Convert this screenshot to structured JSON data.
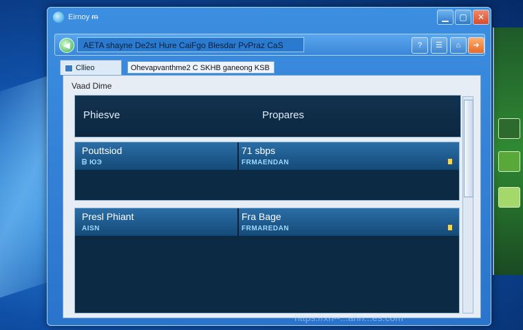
{
  "window": {
    "title": "Eirnoy ᵯ"
  },
  "titlebar_buttons": {
    "minimize": "▁",
    "maximize": "▢",
    "close": "✕"
  },
  "address_bar": {
    "back_glyph": "◀",
    "path": "AETA shayne De2st Hure CaiFgo Blesdar PvPraz CaS",
    "toolbar_glyphs": [
      "?",
      "☰",
      "⌂",
      "➜"
    ]
  },
  "tab": {
    "label": "Cllieo",
    "field_text": "Ohevapvanthme2 C SKHB ganeong KSB"
  },
  "content": {
    "group_label": "Vaad Dime",
    "header": {
      "col_a": "Phiesve",
      "col_b": "Propares"
    },
    "rows": [
      {
        "left_main": "Pouttsiod",
        "left_sub": "ᗷ ЮЭ",
        "right_main": "71 sbps",
        "right_sub": "FRMAENDAN"
      },
      {
        "left_main": "Presl Phiant",
        "left_sub": "AISN",
        "right_main": "Fra Bage",
        "right_sub": "FRMAREDAN"
      }
    ]
  },
  "watermark": "https://xn--...ahn...es.com",
  "colors": {
    "accent": "#2a74cc",
    "panel": "#0d2a44",
    "highlight": "#ffd23a"
  }
}
